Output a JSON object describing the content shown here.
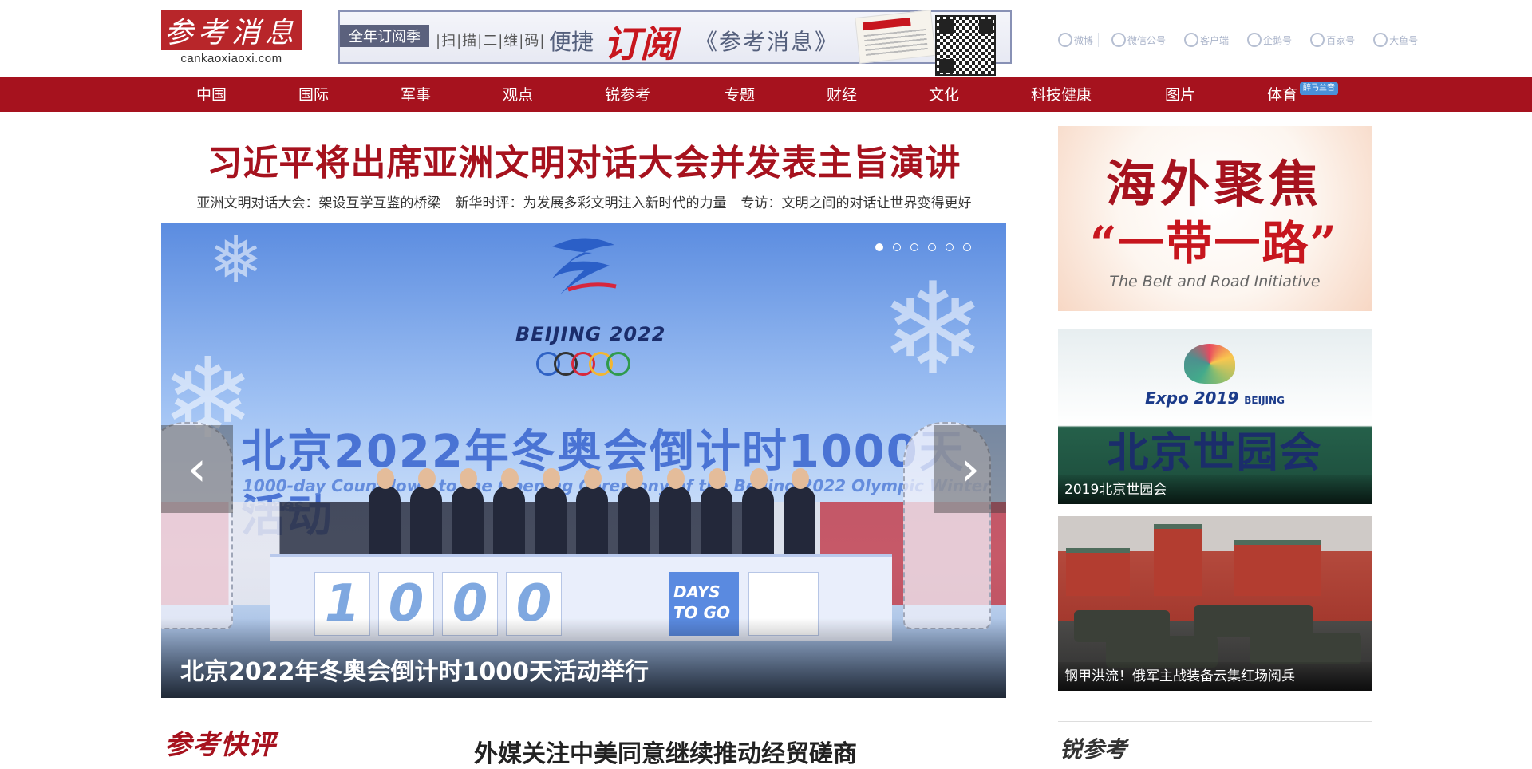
{
  "header": {
    "logo_text": "参考消息",
    "logo_url": "cankaoxiaoxi.com",
    "subscribe": {
      "tag": "全年订阅季",
      "scan": "|扫|描|二|维|码|",
      "convenient": "便捷",
      "subscribe": "订阅",
      "paper": "《参考消息》"
    },
    "social": [
      {
        "label": "微博",
        "icon": "weibo-icon"
      },
      {
        "label": "微信公号",
        "icon": "wechat-icon"
      },
      {
        "label": "客户端",
        "icon": "app-icon"
      },
      {
        "label": "企鹅号",
        "icon": "penguin-icon"
      },
      {
        "label": "百家号",
        "icon": "baijia-icon"
      },
      {
        "label": "大鱼号",
        "icon": "dayu-icon"
      }
    ]
  },
  "nav": {
    "items": [
      "中国",
      "国际",
      "军事",
      "观点",
      "锐参考",
      "专题",
      "财经",
      "文化",
      "科技健康",
      "图片",
      "体育"
    ],
    "badge": "醉马兰音"
  },
  "main": {
    "headline": "习近平将出席亚洲文明对话大会并发表主旨演讲",
    "sub_links": [
      "亚洲文明对话大会：架设互学互鉴的桥梁",
      "新华时评：为发展多彩文明注入新时代的力量",
      "专访：文明之间的对话让世界变得更好"
    ],
    "slider": {
      "caption": "北京2022年冬奥会倒计时1000天活动举行",
      "bj_text": "BEIJING 2022",
      "countdown_cn": "北京2022年冬奥会倒计时1000天活动",
      "countdown_en": "1000-day Countdown to the Opening Ceremony of the Beijing 2022 Olympic Winter Games",
      "digits": [
        "1",
        "0",
        "0",
        "0"
      ],
      "days_line1": "DAYS",
      "days_line2": "TO GO",
      "slide_count": 6,
      "active_slide": 1,
      "prev_glyph": "‹",
      "next_glyph": "›"
    }
  },
  "sidebar": {
    "promo1": {
      "title": "海外聚焦",
      "sub": "“一带一路”",
      "en": "The Belt and Road Initiative"
    },
    "promo2": {
      "expo": "Expo 2019",
      "expo_city": "BEIJING",
      "big": "北京世园会",
      "caption": "2019北京世园会"
    },
    "promo3": {
      "caption": "钢甲洪流！俄军主战装备云集红场阅兵"
    }
  },
  "bottom": {
    "kuaiping": "参考快评",
    "headline": "外媒关注中美同意继续推动经贸磋商",
    "ruicankao": "锐参考"
  },
  "colors": {
    "brand_red": "#a6121e",
    "nav_bg": "#a6121e",
    "headline_red": "#a6121e"
  }
}
